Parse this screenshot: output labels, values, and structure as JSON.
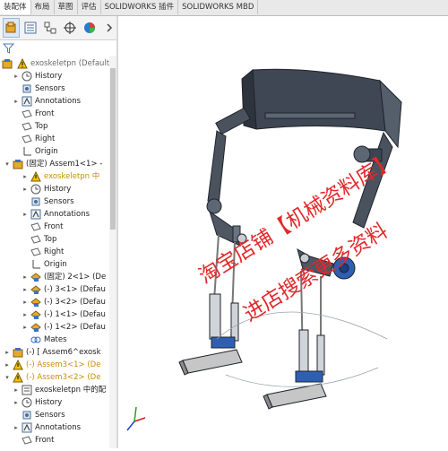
{
  "tabs": [
    "装配体",
    "布局",
    "草图",
    "评估",
    "SOLIDWORKS 插件",
    "SOLIDWORKS MBD"
  ],
  "toolbar_icons": [
    "feature-manager-icon",
    "property-manager-icon",
    "configuration-manager-icon",
    "dimxpert-icon",
    "display-manager-icon",
    "more-chevron-icon"
  ],
  "filter_icon": "filter-icon",
  "tree": {
    "root": "exoskeletpn  (Default<D",
    "items": [
      "History",
      "Sensors",
      "Annotations",
      "Front",
      "Top",
      "Right",
      "Origin",
      "(固定) Assem1<1> -",
      "exoskeletpn 中",
      "History",
      "Sensors",
      "Annotations",
      "Front",
      "Top",
      "Right",
      "Origin",
      "(固定) 2<1> (De",
      "(-) 3<1> (Defau",
      "(-) 3<2> (Defau",
      "(-) 1<1> (Defau",
      "(-) 1<2> (Defau",
      "Mates",
      "(-) [ Assem6^exosk",
      "(-) Assem3<1> (De",
      "(-) Assem3<2> (De",
      "exoskeletpn 中的配",
      "History",
      "Sensors",
      "Annotations",
      "Front"
    ]
  },
  "watermark": {
    "line1": "淘宝店铺【机械资料库】",
    "line2": "进店搜索更多资料"
  },
  "colors": {
    "watermark": "#e2282a",
    "blue_joint": "#2f5fb3",
    "frame": "#3f4754",
    "warning": "#e6b800"
  }
}
